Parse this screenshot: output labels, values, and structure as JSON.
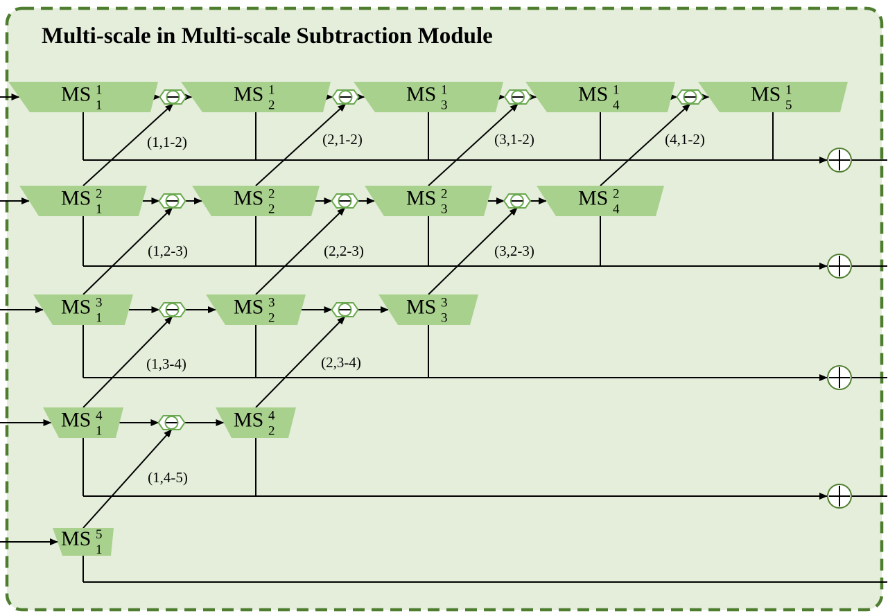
{
  "title": "Multi-scale in Multi-scale Subtraction Module",
  "colors": {
    "panel_fill": "#e4eedb",
    "panel_border": "#4e7d2f",
    "block_fill": "#a9d18e",
    "line": "#000000",
    "node_fill": "#ffffff",
    "node_ring": "#6aa84f"
  },
  "block_base": "MS",
  "operator_symbols": {
    "subtraction": "minus-circle",
    "addition": "plus-circle"
  },
  "rows": [
    {
      "level": 1,
      "blocks": [
        {
          "main": "MS",
          "sup": "1",
          "sub": "1"
        },
        {
          "main": "MS",
          "sup": "1",
          "sub": "2"
        },
        {
          "main": "MS",
          "sup": "1",
          "sub": "3"
        },
        {
          "main": "MS",
          "sup": "1",
          "sub": "4"
        },
        {
          "main": "MS",
          "sup": "1",
          "sub": "5"
        }
      ],
      "labels": [
        "(1,1-2)",
        "(2,1-2)",
        "(3,1-2)",
        "(4,1-2)"
      ]
    },
    {
      "level": 2,
      "blocks": [
        {
          "main": "MS",
          "sup": "2",
          "sub": "1"
        },
        {
          "main": "MS",
          "sup": "2",
          "sub": "2"
        },
        {
          "main": "MS",
          "sup": "2",
          "sub": "3"
        },
        {
          "main": "MS",
          "sup": "2",
          "sub": "4"
        }
      ],
      "labels": [
        "(1,2-3)",
        "(2,2-3)",
        "(3,2-3)"
      ]
    },
    {
      "level": 3,
      "blocks": [
        {
          "main": "MS",
          "sup": "3",
          "sub": "1"
        },
        {
          "main": "MS",
          "sup": "3",
          "sub": "2"
        },
        {
          "main": "MS",
          "sup": "3",
          "sub": "3"
        }
      ],
      "labels": [
        "(1,3-4)",
        "(2,3-4)"
      ]
    },
    {
      "level": 4,
      "blocks": [
        {
          "main": "MS",
          "sup": "4",
          "sub": "1"
        },
        {
          "main": "MS",
          "sup": "4",
          "sub": "2"
        }
      ],
      "labels": [
        "(1,4-5)"
      ]
    },
    {
      "level": 5,
      "blocks": [
        {
          "main": "MS",
          "sup": "5",
          "sub": "1"
        }
      ],
      "labels": []
    }
  ]
}
